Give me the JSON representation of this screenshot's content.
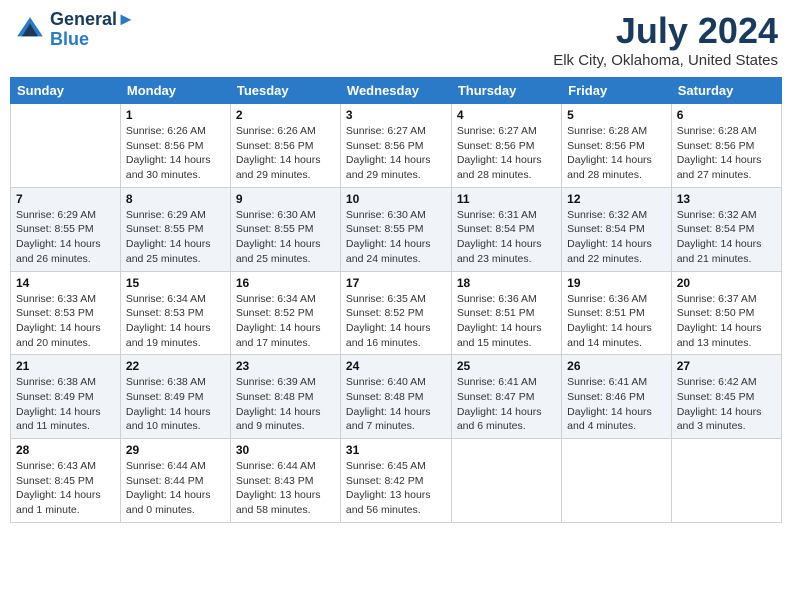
{
  "header": {
    "logo_line1": "General",
    "logo_line2": "Blue",
    "main_title": "July 2024",
    "subtitle": "Elk City, Oklahoma, United States"
  },
  "calendar": {
    "columns": [
      "Sunday",
      "Monday",
      "Tuesday",
      "Wednesday",
      "Thursday",
      "Friday",
      "Saturday"
    ],
    "weeks": [
      [
        {
          "day": "",
          "sunrise": "",
          "sunset": "",
          "daylight": ""
        },
        {
          "day": "1",
          "sunrise": "Sunrise: 6:26 AM",
          "sunset": "Sunset: 8:56 PM",
          "daylight": "Daylight: 14 hours and 30 minutes."
        },
        {
          "day": "2",
          "sunrise": "Sunrise: 6:26 AM",
          "sunset": "Sunset: 8:56 PM",
          "daylight": "Daylight: 14 hours and 29 minutes."
        },
        {
          "day": "3",
          "sunrise": "Sunrise: 6:27 AM",
          "sunset": "Sunset: 8:56 PM",
          "daylight": "Daylight: 14 hours and 29 minutes."
        },
        {
          "day": "4",
          "sunrise": "Sunrise: 6:27 AM",
          "sunset": "Sunset: 8:56 PM",
          "daylight": "Daylight: 14 hours and 28 minutes."
        },
        {
          "day": "5",
          "sunrise": "Sunrise: 6:28 AM",
          "sunset": "Sunset: 8:56 PM",
          "daylight": "Daylight: 14 hours and 28 minutes."
        },
        {
          "day": "6",
          "sunrise": "Sunrise: 6:28 AM",
          "sunset": "Sunset: 8:56 PM",
          "daylight": "Daylight: 14 hours and 27 minutes."
        }
      ],
      [
        {
          "day": "7",
          "sunrise": "Sunrise: 6:29 AM",
          "sunset": "Sunset: 8:55 PM",
          "daylight": "Daylight: 14 hours and 26 minutes."
        },
        {
          "day": "8",
          "sunrise": "Sunrise: 6:29 AM",
          "sunset": "Sunset: 8:55 PM",
          "daylight": "Daylight: 14 hours and 25 minutes."
        },
        {
          "day": "9",
          "sunrise": "Sunrise: 6:30 AM",
          "sunset": "Sunset: 8:55 PM",
          "daylight": "Daylight: 14 hours and 25 minutes."
        },
        {
          "day": "10",
          "sunrise": "Sunrise: 6:30 AM",
          "sunset": "Sunset: 8:55 PM",
          "daylight": "Daylight: 14 hours and 24 minutes."
        },
        {
          "day": "11",
          "sunrise": "Sunrise: 6:31 AM",
          "sunset": "Sunset: 8:54 PM",
          "daylight": "Daylight: 14 hours and 23 minutes."
        },
        {
          "day": "12",
          "sunrise": "Sunrise: 6:32 AM",
          "sunset": "Sunset: 8:54 PM",
          "daylight": "Daylight: 14 hours and 22 minutes."
        },
        {
          "day": "13",
          "sunrise": "Sunrise: 6:32 AM",
          "sunset": "Sunset: 8:54 PM",
          "daylight": "Daylight: 14 hours and 21 minutes."
        }
      ],
      [
        {
          "day": "14",
          "sunrise": "Sunrise: 6:33 AM",
          "sunset": "Sunset: 8:53 PM",
          "daylight": "Daylight: 14 hours and 20 minutes."
        },
        {
          "day": "15",
          "sunrise": "Sunrise: 6:34 AM",
          "sunset": "Sunset: 8:53 PM",
          "daylight": "Daylight: 14 hours and 19 minutes."
        },
        {
          "day": "16",
          "sunrise": "Sunrise: 6:34 AM",
          "sunset": "Sunset: 8:52 PM",
          "daylight": "Daylight: 14 hours and 17 minutes."
        },
        {
          "day": "17",
          "sunrise": "Sunrise: 6:35 AM",
          "sunset": "Sunset: 8:52 PM",
          "daylight": "Daylight: 14 hours and 16 minutes."
        },
        {
          "day": "18",
          "sunrise": "Sunrise: 6:36 AM",
          "sunset": "Sunset: 8:51 PM",
          "daylight": "Daylight: 14 hours and 15 minutes."
        },
        {
          "day": "19",
          "sunrise": "Sunrise: 6:36 AM",
          "sunset": "Sunset: 8:51 PM",
          "daylight": "Daylight: 14 hours and 14 minutes."
        },
        {
          "day": "20",
          "sunrise": "Sunrise: 6:37 AM",
          "sunset": "Sunset: 8:50 PM",
          "daylight": "Daylight: 14 hours and 13 minutes."
        }
      ],
      [
        {
          "day": "21",
          "sunrise": "Sunrise: 6:38 AM",
          "sunset": "Sunset: 8:49 PM",
          "daylight": "Daylight: 14 hours and 11 minutes."
        },
        {
          "day": "22",
          "sunrise": "Sunrise: 6:38 AM",
          "sunset": "Sunset: 8:49 PM",
          "daylight": "Daylight: 14 hours and 10 minutes."
        },
        {
          "day": "23",
          "sunrise": "Sunrise: 6:39 AM",
          "sunset": "Sunset: 8:48 PM",
          "daylight": "Daylight: 14 hours and 9 minutes."
        },
        {
          "day": "24",
          "sunrise": "Sunrise: 6:40 AM",
          "sunset": "Sunset: 8:48 PM",
          "daylight": "Daylight: 14 hours and 7 minutes."
        },
        {
          "day": "25",
          "sunrise": "Sunrise: 6:41 AM",
          "sunset": "Sunset: 8:47 PM",
          "daylight": "Daylight: 14 hours and 6 minutes."
        },
        {
          "day": "26",
          "sunrise": "Sunrise: 6:41 AM",
          "sunset": "Sunset: 8:46 PM",
          "daylight": "Daylight: 14 hours and 4 minutes."
        },
        {
          "day": "27",
          "sunrise": "Sunrise: 6:42 AM",
          "sunset": "Sunset: 8:45 PM",
          "daylight": "Daylight: 14 hours and 3 minutes."
        }
      ],
      [
        {
          "day": "28",
          "sunrise": "Sunrise: 6:43 AM",
          "sunset": "Sunset: 8:45 PM",
          "daylight": "Daylight: 14 hours and 1 minute."
        },
        {
          "day": "29",
          "sunrise": "Sunrise: 6:44 AM",
          "sunset": "Sunset: 8:44 PM",
          "daylight": "Daylight: 14 hours and 0 minutes."
        },
        {
          "day": "30",
          "sunrise": "Sunrise: 6:44 AM",
          "sunset": "Sunset: 8:43 PM",
          "daylight": "Daylight: 13 hours and 58 minutes."
        },
        {
          "day": "31",
          "sunrise": "Sunrise: 6:45 AM",
          "sunset": "Sunset: 8:42 PM",
          "daylight": "Daylight: 13 hours and 56 minutes."
        },
        {
          "day": "",
          "sunrise": "",
          "sunset": "",
          "daylight": ""
        },
        {
          "day": "",
          "sunrise": "",
          "sunset": "",
          "daylight": ""
        },
        {
          "day": "",
          "sunrise": "",
          "sunset": "",
          "daylight": ""
        }
      ]
    ]
  }
}
